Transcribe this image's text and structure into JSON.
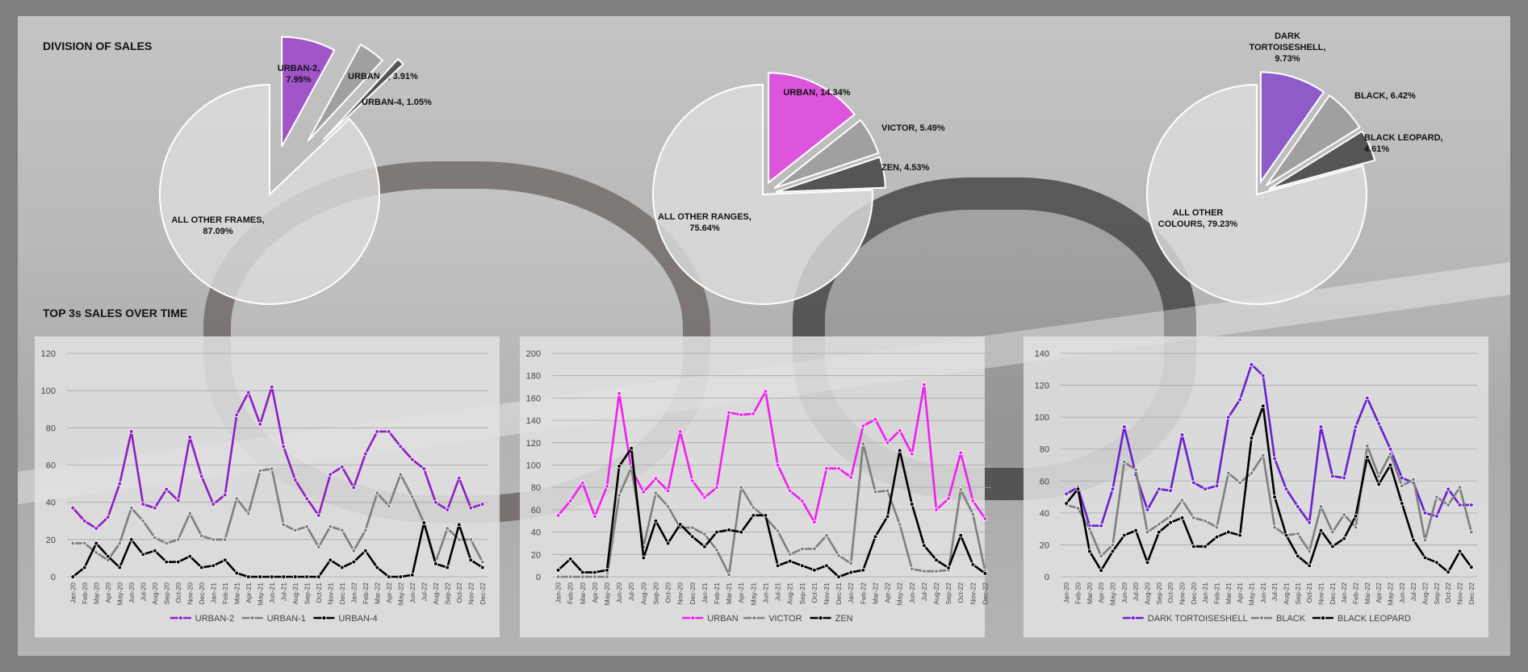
{
  "titles": {
    "division": "DIVISION OF SALES",
    "top3": "TOP 3s SALES OVER TIME"
  },
  "pies": [
    {
      "slices": [
        {
          "label": "URBAN-2,",
          "pct": "7.95%",
          "value": 7.95,
          "color": "#a155c9",
          "explode": 0.45
        },
        {
          "label": "URBAN-1,",
          "pct": "3.91%",
          "value": 3.91,
          "color": "#a0a0a0",
          "explode": 0.6
        },
        {
          "label": "URBAN-4,",
          "pct": "1.05%",
          "value": 1.05,
          "color": "#555555",
          "explode": 0.7
        },
        {
          "label": "ALL OTHER FRAMES,",
          "pct": "87.09%",
          "value": 87.09,
          "color": "#dcdcdc",
          "explode": 0
        }
      ]
    },
    {
      "slices": [
        {
          "label": "URBAN,",
          "pct": "14.34%",
          "value": 14.34,
          "color": "#dd55dd",
          "explode": 0.12
        },
        {
          "label": "VICTOR,",
          "pct": "5.49%",
          "value": 5.49,
          "color": "#a0a0a0",
          "explode": 0.12
        },
        {
          "label": "ZEN,",
          "pct": "4.53%",
          "value": 4.53,
          "color": "#555555",
          "explode": 0.12
        },
        {
          "label": "ALL OTHER RANGES,",
          "pct": "75.64%",
          "value": 75.64,
          "color": "#dcdcdc",
          "explode": 0
        }
      ]
    },
    {
      "slices": [
        {
          "label": "DARK TORTOISESHELL,",
          "pct": "9.73%",
          "value": 9.73,
          "color": "#8e5cc8",
          "explode": 0.12
        },
        {
          "label": "BLACK,",
          "pct": "6.42%",
          "value": 6.42,
          "color": "#a0a0a0",
          "explode": 0.12
        },
        {
          "label": "BLACK LEOPARD,",
          "pct": "4.61%",
          "value": 4.61,
          "color": "#555555",
          "explode": 0.12
        },
        {
          "label": "ALL OTHER COLOURS,",
          "pct": "79.23%",
          "value": 79.23,
          "color": "#dcdcdc",
          "explode": 0
        }
      ]
    }
  ],
  "chart_data": [
    {
      "type": "pie",
      "labels": [
        "URBAN-2",
        "URBAN-1",
        "URBAN-4",
        "ALL OTHER FRAMES"
      ],
      "values": [
        7.95,
        3.91,
        1.05,
        87.09
      ]
    },
    {
      "type": "pie",
      "labels": [
        "URBAN",
        "VICTOR",
        "ZEN",
        "ALL OTHER RANGES"
      ],
      "values": [
        14.34,
        5.49,
        4.53,
        75.64
      ]
    },
    {
      "type": "pie",
      "labels": [
        "DARK TORTOISESHELL",
        "BLACK",
        "BLACK LEOPARD",
        "ALL OTHER COLOURS"
      ],
      "values": [
        9.73,
        6.42,
        4.61,
        79.23
      ]
    },
    {
      "type": "line",
      "x": [
        "Jan-20",
        "Feb-20",
        "Mar-20",
        "Apr-20",
        "May-20",
        "Jun-20",
        "Jul-20",
        "Aug-20",
        "Sep-20",
        "Oct-20",
        "Nov-20",
        "Dec-20",
        "Jan-21",
        "Feb-21",
        "Mar-21",
        "Apr-21",
        "May-21",
        "Jun-21",
        "Jul-21",
        "Aug-21",
        "Sep-21",
        "Oct-21",
        "Nov-21",
        "Dec-21",
        "Jan-22",
        "Feb-22",
        "Mar-22",
        "Apr-22",
        "May-22",
        "Jun-22",
        "Jul-22",
        "Aug-22",
        "Sep-22",
        "Oct-22",
        "Nov-22",
        "Dec-22"
      ],
      "ylim": [
        0,
        120
      ],
      "yticks": [
        0,
        20,
        40,
        60,
        80,
        100,
        120
      ],
      "grid": true,
      "legend": "bottom",
      "series": [
        {
          "name": "URBAN-2",
          "color": "#8e1fc6",
          "values": [
            37,
            30,
            26,
            32,
            50,
            78,
            39,
            37,
            47,
            41,
            75,
            54,
            39,
            44,
            87,
            99,
            82,
            102,
            70,
            52,
            42,
            33,
            55,
            59,
            48,
            66,
            78,
            78,
            70,
            63,
            58,
            40,
            36,
            53,
            37,
            39
          ]
        },
        {
          "name": "URBAN-1",
          "color": "#7f7f7f",
          "values": [
            18,
            18,
            13,
            9,
            18,
            37,
            30,
            21,
            18,
            20,
            34,
            22,
            20,
            20,
            42,
            34,
            57,
            58,
            28,
            25,
            27,
            16,
            27,
            25,
            14,
            25,
            45,
            38,
            55,
            43,
            29,
            8,
            26,
            20,
            20,
            8
          ]
        },
        {
          "name": "URBAN-4",
          "color": "#000000",
          "values": [
            0,
            5,
            18,
            11,
            5,
            20,
            12,
            14,
            8,
            8,
            11,
            5,
            6,
            9,
            2,
            0,
            0,
            0,
            0,
            0,
            0,
            0,
            9,
            5,
            8,
            14,
            5,
            0,
            0,
            1,
            29,
            7,
            5,
            28,
            9,
            5
          ]
        }
      ]
    },
    {
      "type": "line",
      "x": [
        "Jan-20",
        "Feb-20",
        "Mar-20",
        "Apr-20",
        "May-20",
        "Jun-20",
        "Jul-20",
        "Aug-20",
        "Sep-20",
        "Oct-20",
        "Nov-20",
        "Dec-20",
        "Jan-21",
        "Feb-21",
        "Mar-21",
        "Apr-21",
        "May-21",
        "Jun-21",
        "Jul-21",
        "Aug-21",
        "Sep-21",
        "Oct-21",
        "Nov-21",
        "Dec-21",
        "Jan-22",
        "Feb-22",
        "Mar-22",
        "Apr-22",
        "May-22",
        "Jun-22",
        "Jul-22",
        "Aug-22",
        "Sep-22",
        "Oct-22",
        "Nov-22",
        "Dec-22"
      ],
      "ylim": [
        0,
        200
      ],
      "yticks": [
        0,
        20,
        40,
        60,
        80,
        100,
        120,
        140,
        160,
        180,
        200
      ],
      "grid": true,
      "legend": "bottom",
      "series": [
        {
          "name": "URBAN",
          "color": "#f21ef2",
          "values": [
            55,
            68,
            84,
            54,
            81,
            164,
            96,
            76,
            88,
            77,
            130,
            86,
            71,
            80,
            147,
            145,
            146,
            166,
            100,
            77,
            68,
            49,
            97,
            97,
            89,
            135,
            141,
            120,
            131,
            110,
            172,
            60,
            70,
            111,
            68,
            52
          ]
        },
        {
          "name": "VICTOR",
          "color": "#7f7f7f",
          "values": [
            0,
            0,
            0,
            0,
            0,
            73,
            98,
            27,
            75,
            63,
            44,
            44,
            38,
            24,
            2,
            80,
            62,
            53,
            41,
            20,
            25,
            25,
            37,
            19,
            12,
            119,
            76,
            77,
            47,
            7,
            5,
            5,
            6,
            78,
            56,
            5
          ]
        },
        {
          "name": "ZEN",
          "color": "#000000",
          "values": [
            6,
            16,
            4,
            4,
            6,
            99,
            115,
            17,
            50,
            30,
            47,
            36,
            27,
            40,
            42,
            40,
            55,
            55,
            10,
            14,
            10,
            6,
            10,
            0,
            4,
            6,
            36,
            54,
            113,
            65,
            28,
            15,
            8,
            37,
            11,
            3
          ]
        }
      ]
    },
    {
      "type": "line",
      "x": [
        "Jan-20",
        "Feb-20",
        "Mar-20",
        "Apr-20",
        "May-20",
        "Jun-20",
        "Jul-20",
        "Aug-20",
        "Sep-20",
        "Oct-20",
        "Nov-20",
        "Dec-20",
        "Jan-21",
        "Feb-21",
        "Mar-21",
        "Apr-21",
        "May-21",
        "Jun-21",
        "Jul-21",
        "Aug-21",
        "Sep-21",
        "Oct-21",
        "Nov-21",
        "Dec-21",
        "Jan-22",
        "Feb-22",
        "Mar-22",
        "Apr-22",
        "May-22",
        "Jun-22",
        "Jul-22",
        "Aug-22",
        "Sep-22",
        "Oct-22",
        "Nov-22",
        "Dec-22"
      ],
      "ylim": [
        0,
        140
      ],
      "yticks": [
        0,
        20,
        40,
        60,
        80,
        100,
        120,
        140
      ],
      "grid": true,
      "legend": "bottom",
      "series": [
        {
          "name": "DARK TORTOISESHELL",
          "color": "#6a1fd0",
          "values": [
            52,
            56,
            32,
            32,
            55,
            94,
            64,
            42,
            55,
            54,
            89,
            59,
            55,
            57,
            100,
            111,
            133,
            126,
            74,
            55,
            44,
            34,
            94,
            63,
            62,
            94,
            112,
            96,
            80,
            62,
            59,
            40,
            38,
            55,
            45,
            45
          ]
        },
        {
          "name": "BLACK",
          "color": "#7f7f7f",
          "values": [
            45,
            43,
            30,
            13,
            20,
            72,
            67,
            28,
            33,
            38,
            48,
            37,
            35,
            31,
            65,
            59,
            65,
            76,
            31,
            26,
            27,
            16,
            44,
            28,
            39,
            31,
            82,
            63,
            77,
            57,
            61,
            23,
            50,
            45,
            56,
            28
          ]
        },
        {
          "name": "BLACK LEOPARD",
          "color": "#000000",
          "values": [
            46,
            55,
            16,
            4,
            16,
            26,
            29,
            9,
            28,
            34,
            37,
            19,
            19,
            25,
            28,
            26,
            87,
            107,
            50,
            26,
            13,
            7,
            29,
            19,
            24,
            38,
            75,
            58,
            70,
            46,
            23,
            12,
            9,
            3,
            16,
            6
          ]
        }
      ]
    }
  ]
}
